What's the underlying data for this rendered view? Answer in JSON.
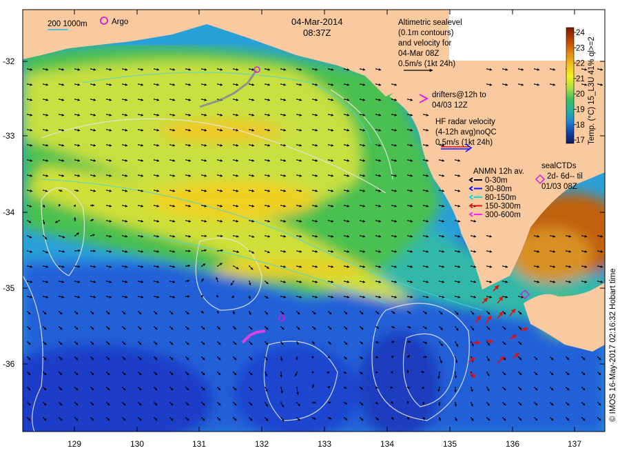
{
  "map": {
    "date": "04-Mar-2014",
    "time": "08:37Z",
    "x_ticks": [
      "129",
      "130",
      "131",
      "132",
      "133",
      "134",
      "135",
      "136",
      "137"
    ],
    "y_ticks": [
      "-32",
      "-33",
      "-34",
      "-35",
      "-36"
    ],
    "scale_bar": "200  1000m",
    "argo_label": "Argo",
    "altimetry": [
      "Altimetric sealevel",
      "(0.1m contours)",
      "and velocity for",
      "04-Mar 08Z",
      "0.5m/s (1kt 24h)"
    ],
    "drifters": [
      "drifters@12h to",
      "04/03 12Z"
    ],
    "hf_radar": [
      "HF radar velocity",
      "(4-12h avg)noQC",
      "0.5m/s (1kt 24h)"
    ],
    "anmn": {
      "title": "ANMN 12h av.",
      "items": [
        {
          "label": "0-30m",
          "color": "#000000"
        },
        {
          "label": "30-80m",
          "color": "#1010ff"
        },
        {
          "label": "80-150m",
          "color": "#00dddd"
        },
        {
          "label": "150-300m",
          "color": "#ee1111"
        },
        {
          "label": "300-600m",
          "color": "#ff22ff"
        }
      ]
    },
    "sealctds": [
      "sealCTDs",
      "2d- 6d-- til",
      "01/03 08Z"
    ],
    "colorbar": {
      "label": "Temp. (°C) 15_L3U 41% ql>=2",
      "ticks": [
        "24",
        "23",
        "22",
        "21",
        "20",
        "19",
        "18",
        "17"
      ],
      "colors": [
        "#7a1a00",
        "#c04a00",
        "#e08a10",
        "#f0c020",
        "#f5f020",
        "#b0e040",
        "#40c060",
        "#20b0a0",
        "#2080d0",
        "#1040a0",
        "#101860"
      ]
    },
    "credit": "© IMOS 16-May-2017 02:16:32 Hobart time",
    "colors": {
      "land": "#f9c9a0",
      "ocean_deep": "#1a4ad0",
      "ocean_mid": "#20b0c0",
      "ocean_warm": "#d8e830"
    }
  }
}
